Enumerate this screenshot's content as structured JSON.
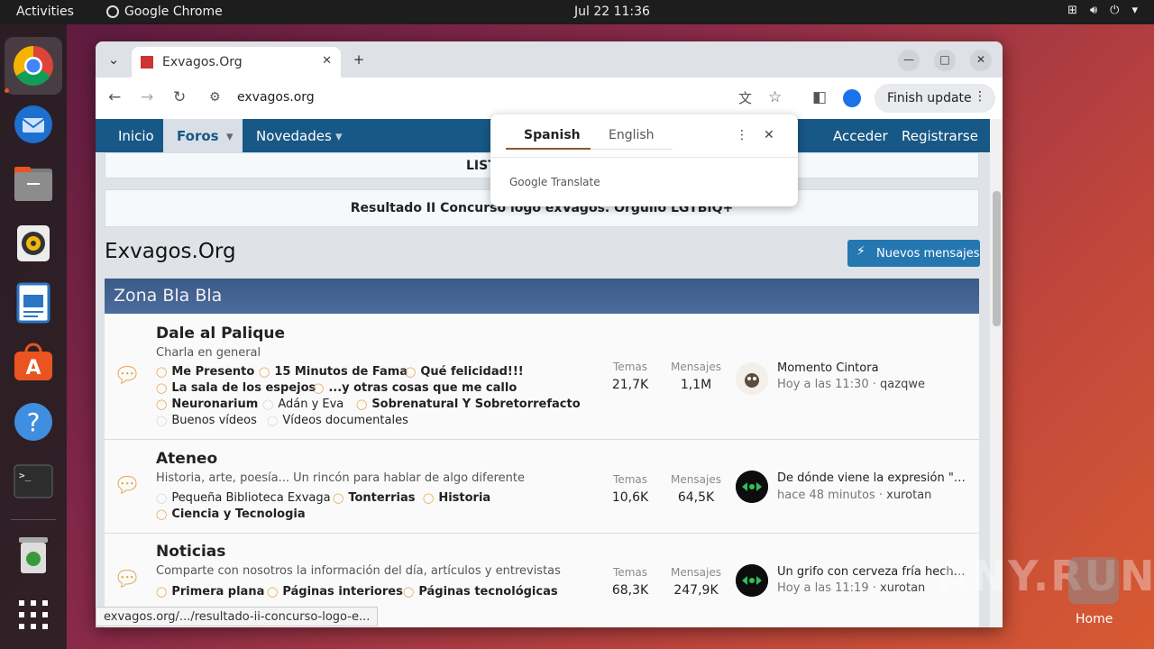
{
  "topbar": {
    "activities": "Activities",
    "app_name": "Google Chrome",
    "clock": "Jul 22  11:36"
  },
  "dock": {
    "items": [
      "chrome-icon",
      "thunderbird-icon",
      "files-icon",
      "rhythmbox-icon",
      "writer-icon",
      "app-center-icon",
      "help-icon",
      "terminal-icon",
      "trash-icon",
      "app-grid-icon"
    ]
  },
  "browser": {
    "tab_title": "Exvagos.Org",
    "url": "exvagos.org",
    "finish_update": "Finish update",
    "status_url": "exvagos.org/.../resultado-ii-concurso-logo-e..."
  },
  "translate": {
    "lang_from": "Spanish",
    "lang_to": "English",
    "brand": "Google Translate"
  },
  "nav": {
    "inicio": "Inicio",
    "foros": "Foros",
    "novedades": "Novedades",
    "acceder": "Acceder",
    "registrarse": "Registrarse"
  },
  "notices": {
    "listado": "LISTADO DE SERVIDO",
    "resultado": "Resultado II Concurso logo exVagos. Orgullo LGTBIQ+"
  },
  "page": {
    "title": "Exvagos.Org",
    "new_messages": "Nuevos mensajes",
    "category": "Zona Bla Bla"
  },
  "stats_labels": {
    "temas": "Temas",
    "mensajes": "Mensajes"
  },
  "forums": [
    {
      "name": "Dale al Palique",
      "desc": "Charla en general",
      "subs": [
        "Me Presento",
        "15 Minutos de Fama",
        "Qué felicidad!!!",
        "La sala de los espejos",
        "...y otras cosas que me callo",
        "Neuronarium",
        "Adán y Eva",
        "Sobrenatural Y Sobretorrefacto",
        "Buenos vídeos",
        "Vídeos documentales"
      ],
      "temas": "21,7K",
      "mensajes": "1,1M",
      "last_title": "Momento Cintora",
      "last_time": "Hoy a las 11:30",
      "last_user": "qazqwe"
    },
    {
      "name": "Ateneo",
      "desc": "Historia, arte, poesía... Un rincón para hablar de algo diferente",
      "subs": [
        "Pequeña Biblioteca Exvaga",
        "Tonterrias",
        "Historia",
        "Ciencia y Tecnologia"
      ],
      "temas": "10,6K",
      "mensajes": "64,5K",
      "last_title": "De dónde viene la expresión \"esta...",
      "last_time": "hace 48 minutos",
      "last_user": "xurotan"
    },
    {
      "name": "Noticias",
      "desc": "Comparte con nosotros la información del día, artículos y entrevistas",
      "subs": [
        "Primera plana",
        "Páginas interiores",
        "Páginas tecnológicas"
      ],
      "temas": "68,3K",
      "mensajes": "247,9K",
      "last_title": "Un grifo con cerveza fría hecha en...",
      "last_time": "Hoy a las 11:19",
      "last_user": "xurotan"
    }
  ],
  "sep": "·",
  "desktop": {
    "home_label": "Home",
    "watermark": "ANY.RUN"
  }
}
